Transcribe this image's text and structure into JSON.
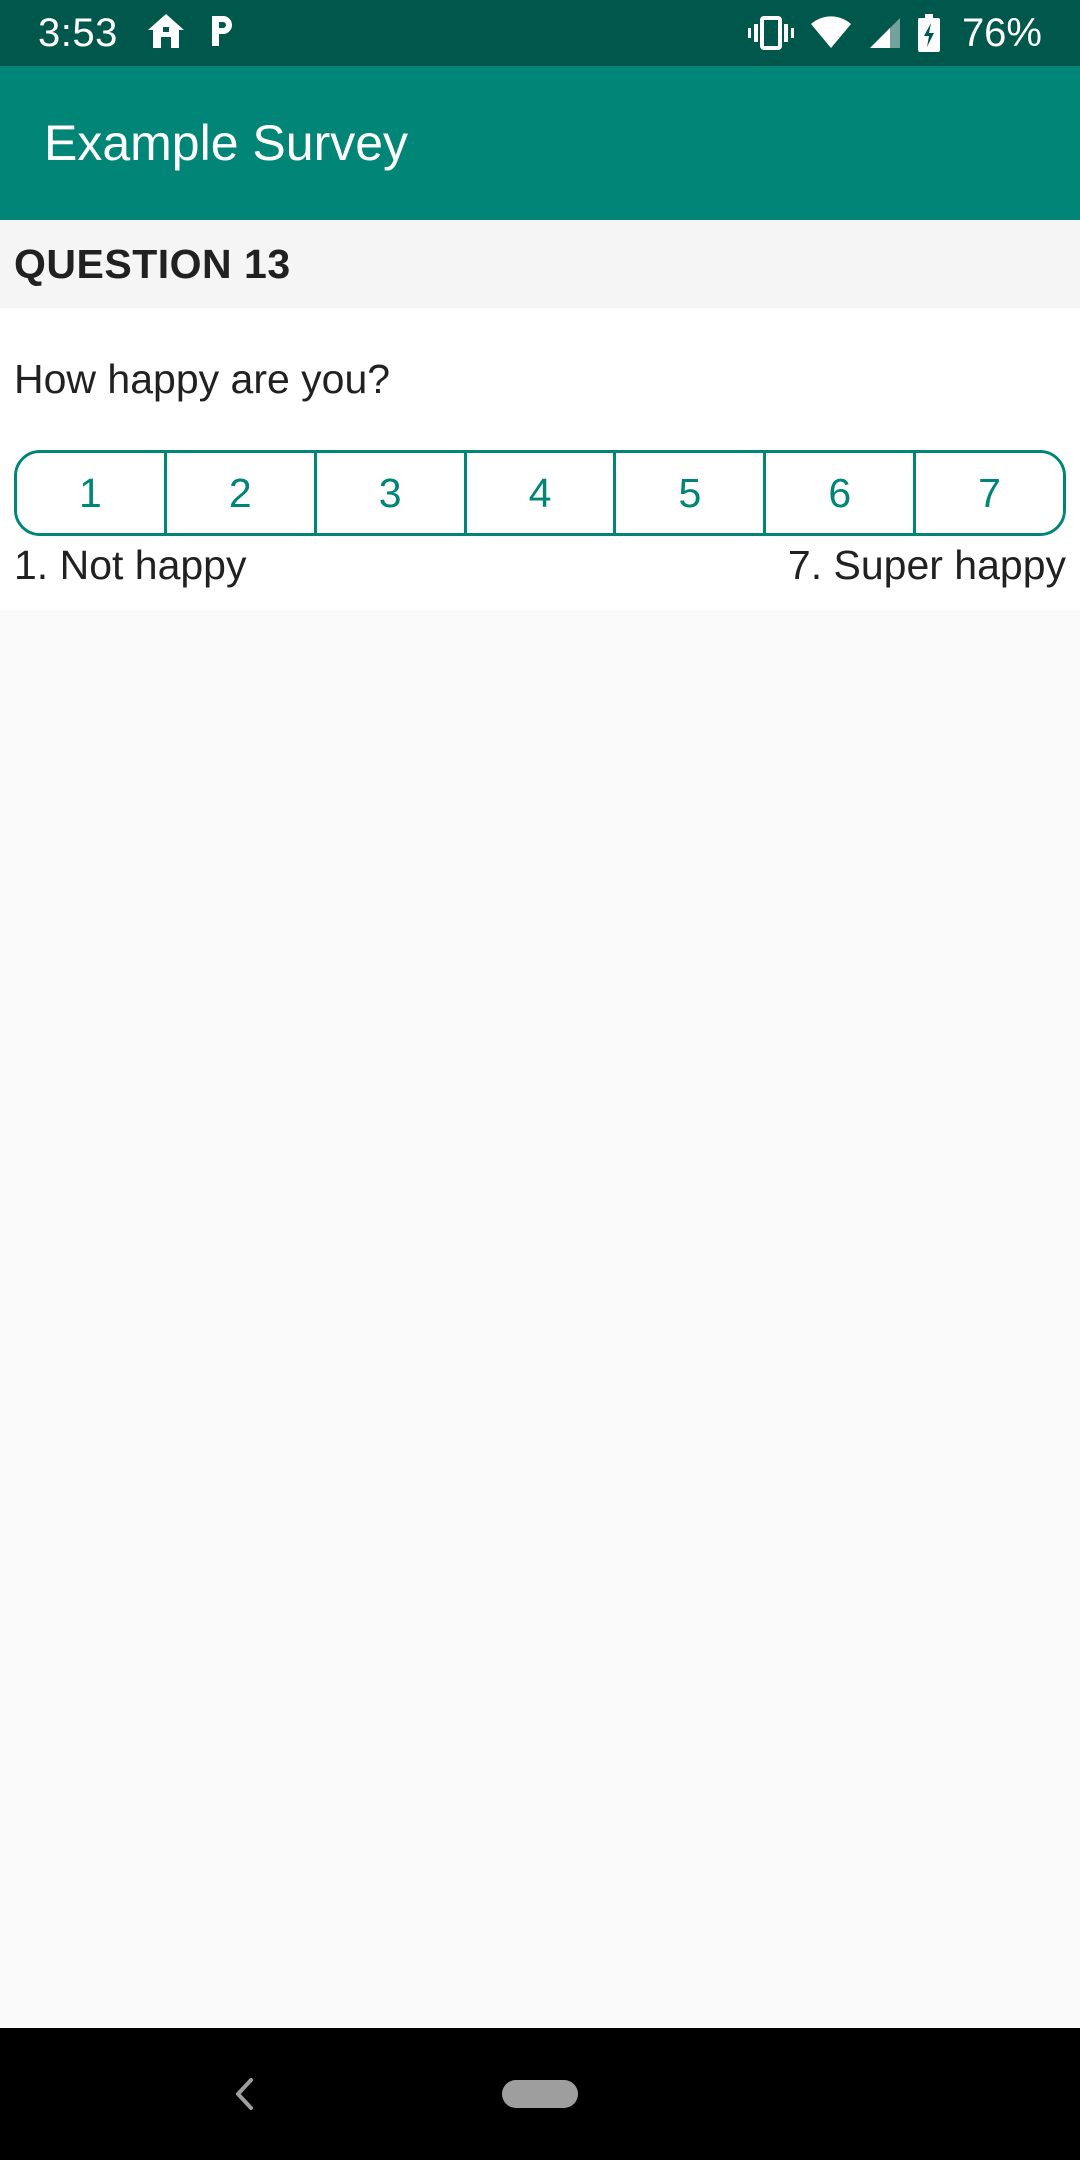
{
  "status_bar": {
    "time": "3:53",
    "battery": "76%",
    "icons": [
      "home-icon",
      "parking-icon",
      "vibrate-icon",
      "wifi-icon",
      "cell-signal-icon",
      "battery-charging-icon"
    ]
  },
  "app_bar": {
    "title": "Example Survey"
  },
  "question": {
    "header": "QUESTION 13",
    "text": "How happy are you?",
    "options": [
      "1",
      "2",
      "3",
      "4",
      "5",
      "6",
      "7"
    ],
    "min_label": "1. Not happy",
    "max_label": "7. Super happy"
  },
  "nav_bar": {
    "icons": [
      "back-icon",
      "home-pill"
    ]
  },
  "colors": {
    "primary": "#008577",
    "primary_dark": "#00574b",
    "text": "#212121",
    "background": "#fafafa"
  }
}
